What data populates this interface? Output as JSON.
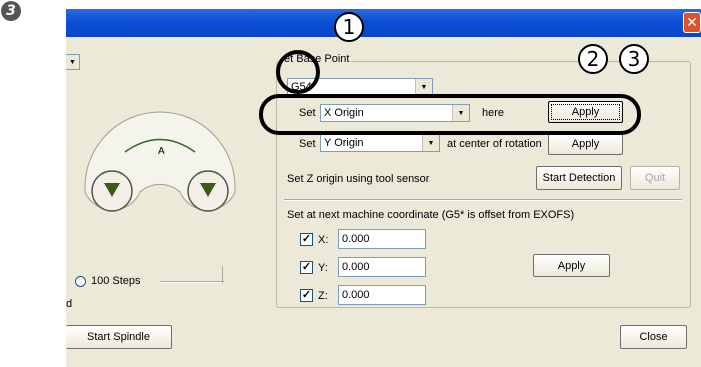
{
  "step_badge": "3",
  "window": {
    "close_symbol": "✕"
  },
  "jog": {
    "label": "A",
    "left_arrow": "▼",
    "right_arrow": "▼"
  },
  "steps": {
    "label": "100 Steps",
    "cut_letter": "d"
  },
  "base_point": {
    "title": "et Base Point",
    "coord_system": "G54",
    "set_label_1": "Set",
    "axis_1": "X Origin",
    "here_label": "here",
    "apply_label": "Apply",
    "set_label_2": "Set",
    "axis_2": "Y Origin",
    "rotation_label": "at center of rotation",
    "z_label": "Set Z origin using tool sensor",
    "start_detection": "Start Detection",
    "quit": "Quit"
  },
  "machine_coord": {
    "title": "Set at next machine coordinate  (G5* is offset from EXOFS)",
    "x_label": "X:",
    "x_value": "0.000",
    "y_label": "Y:",
    "y_value": "0.000",
    "z_label": "Z:",
    "z_value": "0.000",
    "check_mark": "✓",
    "apply_label": "Apply"
  },
  "buttons": {
    "start_spindle": "Start Spindle",
    "close": "Close"
  },
  "callouts": {
    "one": "1",
    "two": "2",
    "three": "3"
  }
}
